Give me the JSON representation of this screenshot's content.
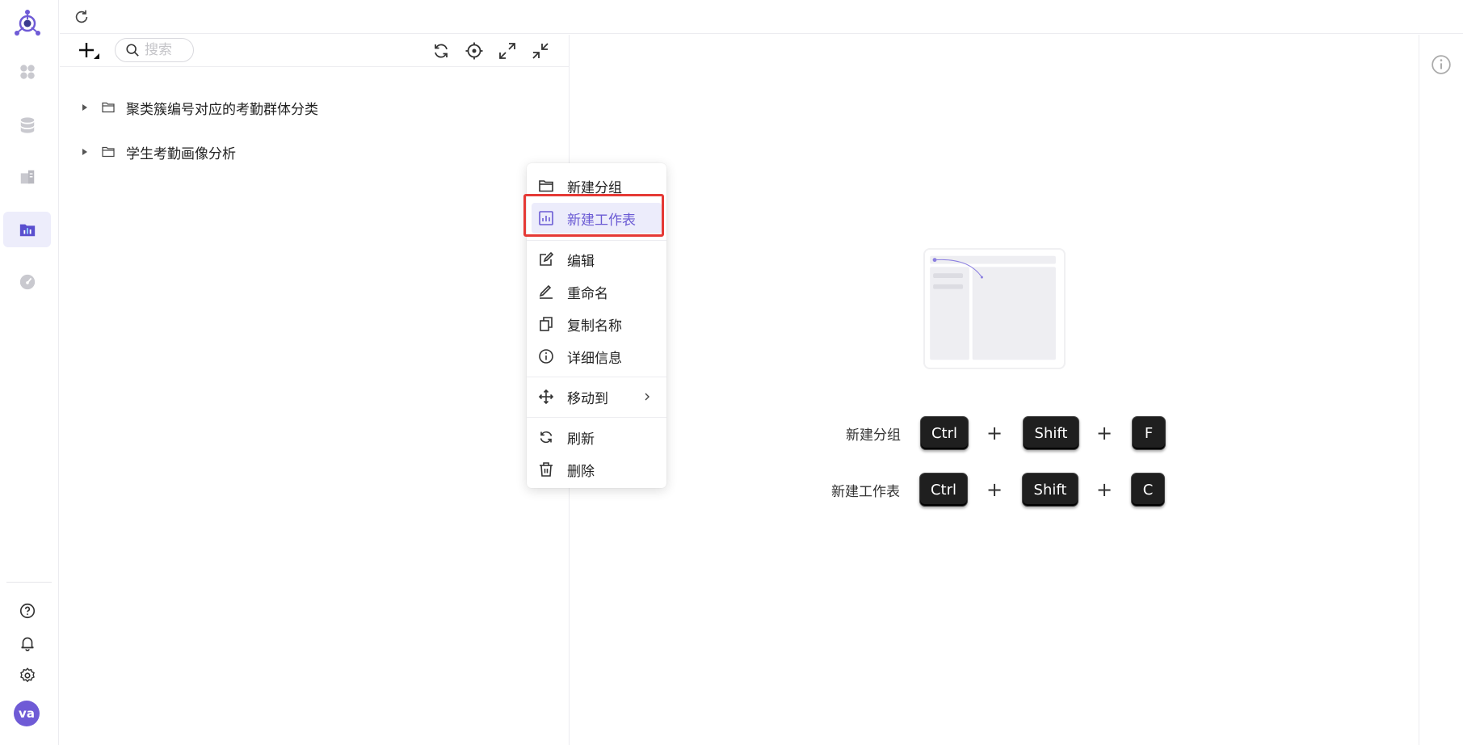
{
  "rail": {
    "items": [
      {
        "name": "dashboard",
        "active": false
      },
      {
        "name": "data-source",
        "active": false
      },
      {
        "name": "dataset",
        "active": false
      },
      {
        "name": "worksheet",
        "active": true
      },
      {
        "name": "monitor",
        "active": false
      }
    ],
    "avatar_text": "va",
    "colors": {
      "accent": "#6f5bd6",
      "active_bg": "#ededfb"
    }
  },
  "panel": {
    "search_placeholder": "搜索",
    "tree": [
      {
        "label": "聚类簇编号对应的考勤群体分类"
      },
      {
        "label": "学生考勤画像分析"
      }
    ]
  },
  "context_menu": {
    "items": [
      {
        "label": "新建分组",
        "icon": "folder-icon"
      },
      {
        "label": "新建工作表",
        "icon": "chart-icon",
        "highlighted": true
      },
      {
        "label": "编辑",
        "icon": "edit-icon"
      },
      {
        "label": "重命名",
        "icon": "pencil-icon"
      },
      {
        "label": "复制名称",
        "icon": "copy-icon"
      },
      {
        "label": "详细信息",
        "icon": "info-icon"
      },
      {
        "label": "移动到",
        "icon": "move-icon",
        "submenu": true
      },
      {
        "label": "刷新",
        "icon": "refresh-icon"
      },
      {
        "label": "删除",
        "icon": "trash-icon"
      }
    ]
  },
  "shortcuts": [
    {
      "label": "新建分组",
      "keys": [
        "Ctrl",
        "Shift",
        "F"
      ]
    },
    {
      "label": "新建工作表",
      "keys": [
        "Ctrl",
        "Shift",
        "C"
      ]
    }
  ],
  "shortcut_plus": "+"
}
